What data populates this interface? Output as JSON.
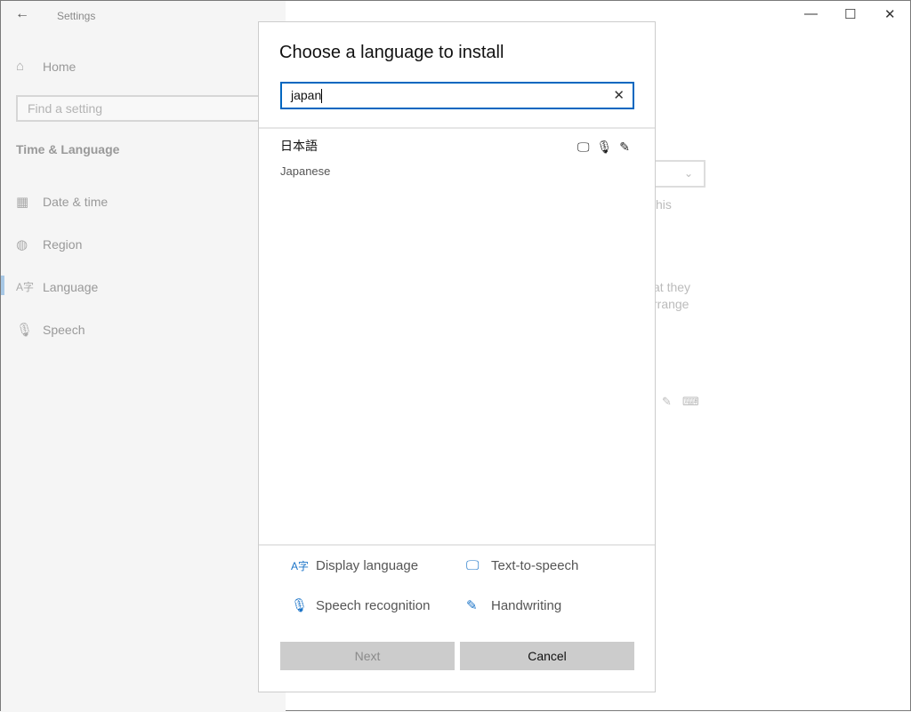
{
  "window": {
    "title": "Settings",
    "minimize_icon": "minimize-icon",
    "maximize_icon": "maximize-icon",
    "close_icon": "close-icon"
  },
  "sidebar": {
    "home": "Home",
    "search_placeholder": "Find a setting",
    "section": "Time & Language",
    "items": [
      {
        "label": "Date & time",
        "icon": "calendar-clock-icon"
      },
      {
        "label": "Region",
        "icon": "globe-icon"
      },
      {
        "label": "Language",
        "icon": "language-icon",
        "selected": true
      },
      {
        "label": "Speech",
        "icon": "microphone-icon"
      }
    ]
  },
  "background": {
    "line1": "his",
    "line2": "at they",
    "line3": "rrange"
  },
  "dialog": {
    "title": "Choose a language to install",
    "search_value": "japan",
    "results": [
      {
        "native": "日本語",
        "english": "Japanese",
        "features": [
          "text-to-speech",
          "speech-recognition",
          "handwriting"
        ]
      }
    ],
    "legend": {
      "display": "Display language",
      "tts": "Text-to-speech",
      "speech": "Speech recognition",
      "handwriting": "Handwriting"
    },
    "next": "Next",
    "cancel": "Cancel"
  },
  "colors": {
    "accent": "#0067c0",
    "icon_blue": "#1a73c7"
  }
}
